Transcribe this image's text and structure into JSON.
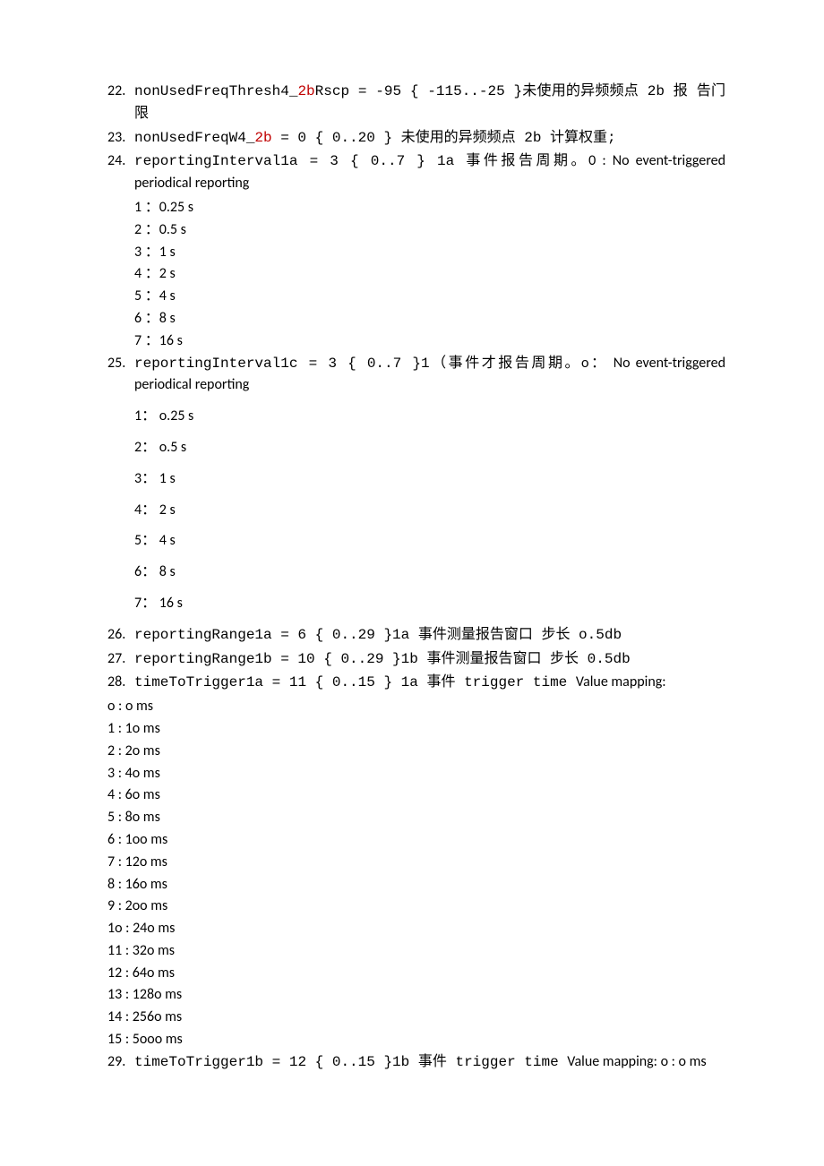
{
  "items": {
    "i22": {
      "num": "22.",
      "param": "nonUsedFreqThresh4_",
      "param_red": "2b",
      "rest": "Rscp = -95 { -115..-25 }未使用的异频频点 2b 报 告门限"
    },
    "i23": {
      "num": "23.",
      "param": "nonUsedFreqW4_",
      "param_red": "2b",
      "rest": " = 0 { 0..20 } 未使用的异频频点 2b 计算权重;"
    },
    "i24": {
      "num": "24.",
      "param": "reportingInterval1a",
      "rest": " = 3 { 0..7 } 1a 事件报告周期。",
      "tail": "0 : No event-triggered periodical reporting",
      "list": [
        "1 ：0.25 s",
        "2 ：0.5 s",
        "3 ：1 s",
        "4 ：2 s",
        "5 ：4 s",
        "6 ：8 s",
        "7 ：16 s"
      ]
    },
    "i25": {
      "num": "25.",
      "param": "reportingInterval1c",
      "rest": " = 3 { 0..7 }1（事件才报告周期。",
      "tail": "o： No event-triggered periodical reporting",
      "list": [
        "1： o.25 s",
        "2： o.5 s",
        "3：  1 s",
        "4：  2 s",
        "5：  4 s",
        "6：  8 s",
        "7：  16 s"
      ]
    },
    "i26": {
      "num": "26.",
      "param": "reportingRange1a",
      "rest": " = 6 { 0..29 }1a 事件测量报告窗口 步长 o.5db"
    },
    "i27": {
      "num": "27.",
      "param": "reportingRange1b",
      "rest": " = 10 { 0..29 }1b 事件测量报告窗口 步长 0.5db"
    },
    "i28": {
      "num": "28.",
      "param": "timeToTrigger1a",
      "rest": " = 11 { 0..15 } 1a 事件 trigger time ",
      "tail": "Value mapping:",
      "list": [
        "o : o ms",
        "1 : 1o ms",
        "2 : 2o ms",
        "3 : 4o ms",
        "4 : 6o ms",
        "5 : 8o ms",
        "6 : 1oo ms",
        "7 : 12o ms",
        "8 : 16o ms",
        "9 : 2oo ms",
        "1o : 24o ms",
        "11 : 32o ms",
        "12 : 64o ms",
        "13 : 128o ms",
        "14 : 256o ms",
        "15 : 5ooo ms"
      ]
    },
    "i29": {
      "num": "29.",
      "param": "timeToTrigger1b",
      "rest": " = 12 { 0..15 }1b 事件 trigger time ",
      "tail": "Value mapping: o : o ms"
    }
  }
}
